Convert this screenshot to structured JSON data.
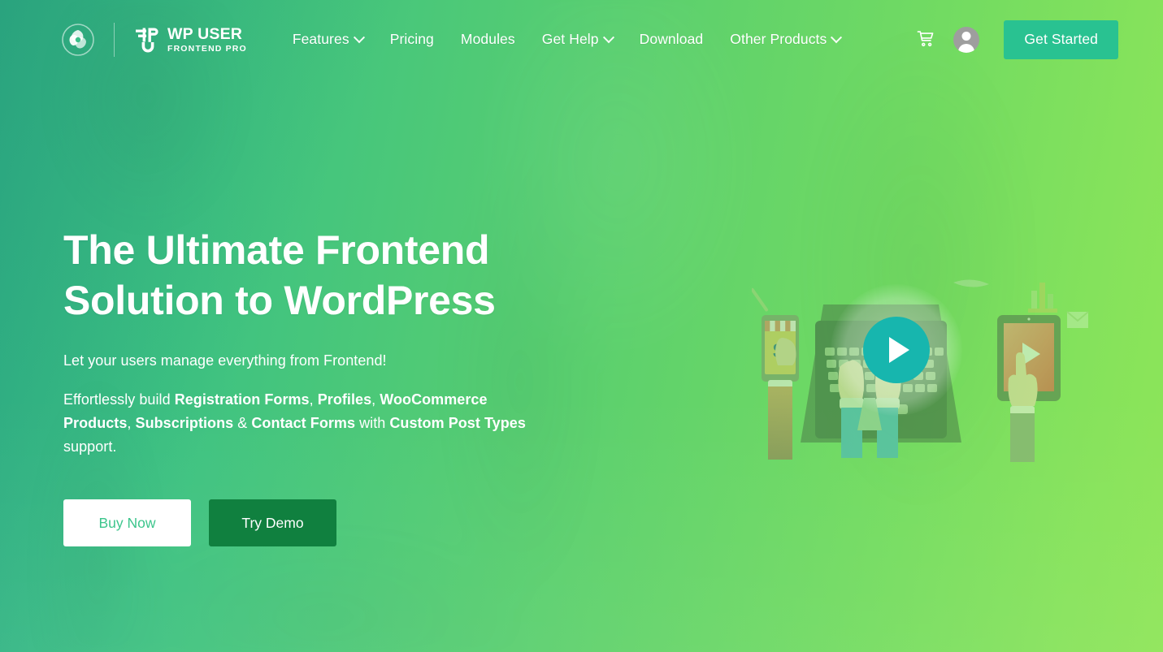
{
  "brand": {
    "mark_icon": "swirl-logo-icon",
    "logo_icon": "wpuf-bolt-icon",
    "name": "WP USER",
    "tagline": "FRONTEND PRO"
  },
  "nav": {
    "items": [
      {
        "label": "Features",
        "has_dropdown": true
      },
      {
        "label": "Pricing",
        "has_dropdown": false
      },
      {
        "label": "Modules",
        "has_dropdown": false
      },
      {
        "label": "Get Help",
        "has_dropdown": true
      },
      {
        "label": "Download",
        "has_dropdown": false
      },
      {
        "label": "Other Products",
        "has_dropdown": true
      }
    ]
  },
  "header_actions": {
    "cart_icon": "shopping-cart-icon",
    "account_icon": "user-avatar-icon",
    "get_started_label": "Get Started"
  },
  "hero": {
    "headline_line1": "The Ultimate Frontend",
    "headline_line2": "Solution to WordPress",
    "tagline": "Let your users manage everything from Frontend!",
    "description": {
      "part1": "Effortlessly build ",
      "bold1": "Registration Forms",
      "part2": ", ",
      "bold2": "Profiles",
      "part3": ", ",
      "bold3": "WooCommerce Products",
      "part4": ", ",
      "bold4": "Subscriptions",
      "part5": " & ",
      "bold5": "Contact Forms",
      "part6": " with ",
      "bold6": "Custom Post Types",
      "part7": " support."
    },
    "buy_label": "Buy Now",
    "demo_label": "Try Demo",
    "play_icon": "play-button-icon",
    "illustration": "laptop-hands-phone-tablet-illustration"
  },
  "colors": {
    "gradient_start": "#2fb58c",
    "gradient_end": "#8ee558",
    "accent_teal": "#29c291",
    "play_button": "#17b6ae",
    "demo_button": "#10803f",
    "buy_text": "#3cc58c",
    "white": "#ffffff"
  }
}
